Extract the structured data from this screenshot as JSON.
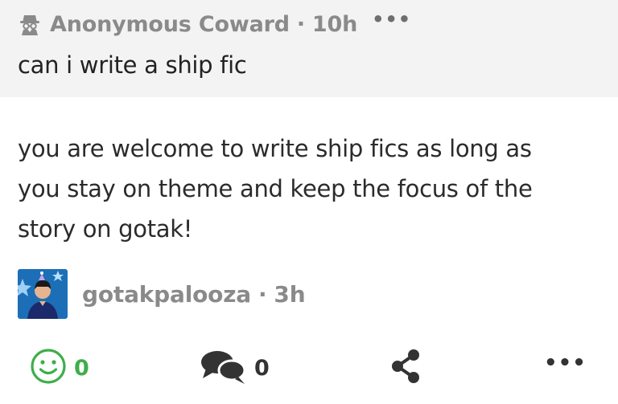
{
  "question": {
    "author": "Anonymous Coward",
    "separator": "·",
    "time": "10h",
    "more_label": "•••",
    "text": "can i write a ship fic"
  },
  "answer": {
    "lines": [
      "you are welcome to write ship fics as long as",
      "you stay on theme and keep the focus of the",
      "story on gotak!"
    ],
    "author": "gotakpalooza",
    "separator": "·",
    "time": "3h"
  },
  "actions": {
    "smile_count": "0",
    "comment_count": "0",
    "more_label": "•••"
  },
  "icons": {
    "anon": "spy-icon",
    "smile": "smile-icon",
    "comment": "comment-bubbles-icon",
    "share": "share-icon",
    "more": "more-dots-icon"
  },
  "colors": {
    "question_bg": "#f3f3f3",
    "accent_green": "#3eae4a",
    "meta_gray": "#8a8a8a",
    "text_dark": "#2b2b2b"
  }
}
